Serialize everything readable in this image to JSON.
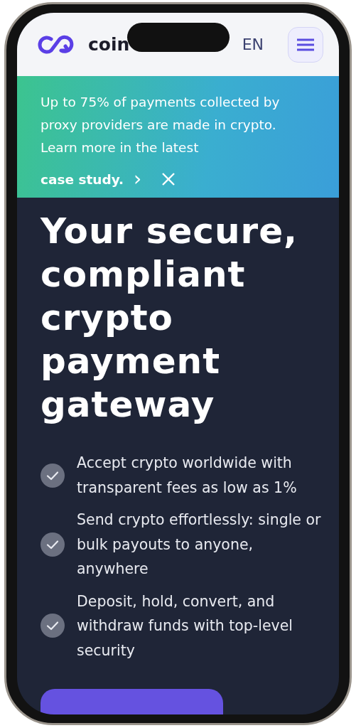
{
  "header": {
    "logo_text": "coin",
    "language": "EN"
  },
  "banner": {
    "text": "Up to 75% of payments collected by proxy providers are made in crypto. Learn more in the latest",
    "link": "case study.",
    "link_arrow": "›"
  },
  "hero": {
    "title": "Your secure, compliant crypto payment gateway",
    "features": [
      {
        "text": "Accept crypto worldwide with transparent fees as low as 1%",
        "checked": true
      },
      {
        "text": "Send crypto effortlessly: single or bulk payouts to anyone, anywhere",
        "checked": true
      },
      {
        "text": "Deposit, hold, convert, and withdraw funds with top-level security",
        "checked": true
      }
    ]
  }
}
